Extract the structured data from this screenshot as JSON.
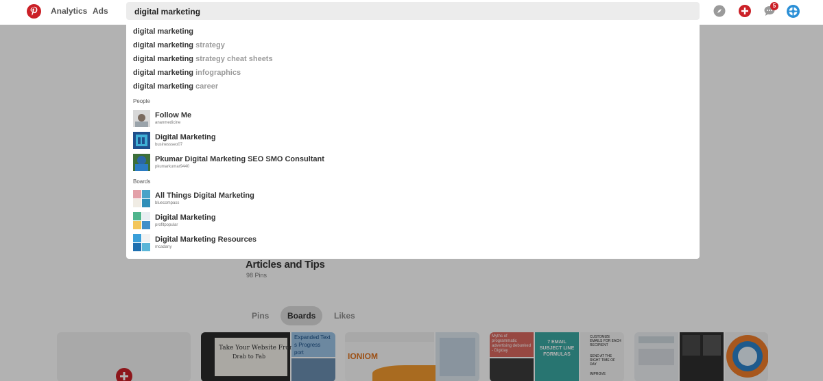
{
  "header": {
    "nav": [
      "Analytics",
      "Ads"
    ],
    "search": {
      "value": "digital marketing",
      "placeholder": ""
    },
    "notifications_count": "5",
    "colors": {
      "brand": "#cb2027",
      "accent": "#2b8fd6"
    },
    "icons": [
      "pinterest-logo-icon",
      "compass-icon",
      "add-pin-icon",
      "messages-icon",
      "profile-icon"
    ]
  },
  "dropdown": {
    "suggestions": [
      {
        "q": "digital marketing",
        "rest": ""
      },
      {
        "q": "digital marketing",
        "rest": "strategy"
      },
      {
        "q": "digital marketing",
        "rest": "strategy cheat sheets"
      },
      {
        "q": "digital marketing",
        "rest": "infographics"
      },
      {
        "q": "digital marketing",
        "rest": "career"
      }
    ],
    "people_label": "People",
    "people": [
      {
        "name": "Follow Me",
        "username": "ananmedicine"
      },
      {
        "name": "Digital Marketing",
        "username": "businessseo07"
      },
      {
        "name": "Pkumar Digital Marketing SEO SMO Consultant",
        "username": "pkumarkumar9440"
      }
    ],
    "boards_label": "Boards",
    "boards": [
      {
        "name": "All Things Digital Marketing",
        "username": "bluecompass"
      },
      {
        "name": "Digital Marketing",
        "username": "profitpopular"
      },
      {
        "name": "Digital Marketing Resources",
        "username": "mcadany"
      }
    ]
  },
  "page": {
    "board_title": "Articles and Tips",
    "pin_count": "98 Pins",
    "tabs": [
      "Pins",
      "Boards",
      "Likes"
    ],
    "active_tab": "Boards",
    "cards": [
      {
        "text": [
          "Take Your Website From",
          "Drab to Fab",
          "Expanded Text",
          "s Progress",
          "port"
        ]
      },
      {
        "text": [
          "IONIOM"
        ]
      },
      {
        "text": [
          "Myths of programmatic advertising debunked - Digiday",
          "7 EMAIL SUBJECT LINE FORMULAS",
          "CUSTOMIZE EMAILS FOR EACH RECIPIENT",
          "SEND AT THE RIGHT TIME OF DAY",
          "IMPROVE"
        ]
      },
      {
        "text": []
      }
    ]
  }
}
